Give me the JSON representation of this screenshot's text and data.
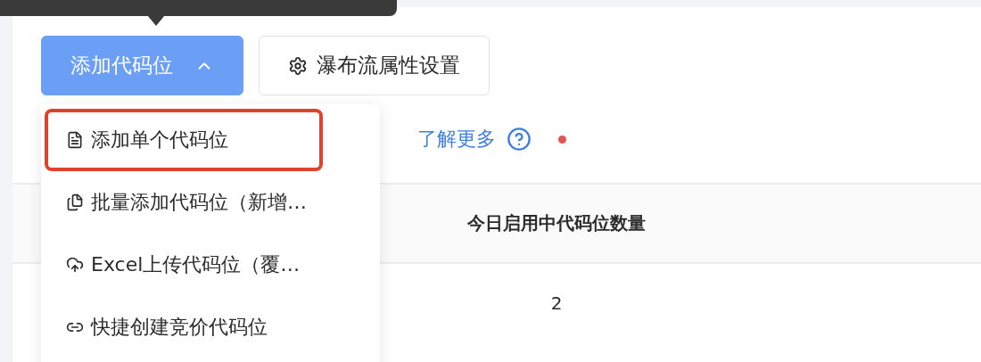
{
  "toolbar": {
    "buttons": [
      {
        "kind": "dropdown",
        "label": "添加代码位",
        "expanded": true
      },
      {
        "kind": "settings",
        "label": "瀑布流属性设置"
      }
    ]
  },
  "info": {
    "link": "了解更多"
  },
  "table": {
    "columns": [
      "今日启用中代码位数量"
    ],
    "rows": [
      [
        "2"
      ]
    ]
  },
  "menu": {
    "items": [
      {
        "kind": "file",
        "label": "添加单个代码位",
        "highlighted": true
      },
      {
        "kind": "files",
        "label": "批量添加代码位（新增…",
        "highlighted": false
      },
      {
        "kind": "upload",
        "label": "Excel上传代码位（覆…",
        "highlighted": false
      },
      {
        "kind": "link",
        "label": "快捷创建竞价代码位",
        "highlighted": false
      }
    ]
  }
}
